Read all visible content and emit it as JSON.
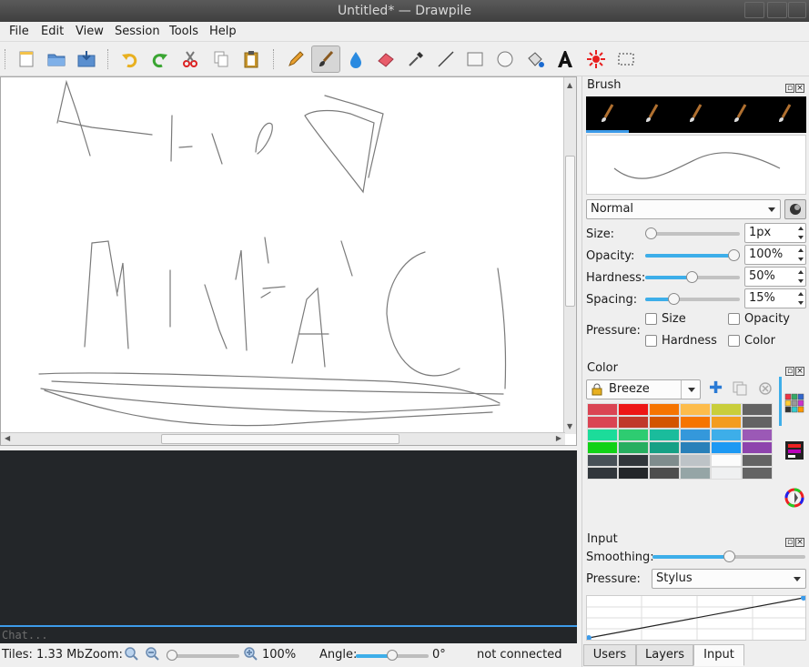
{
  "window": {
    "title": "Untitled* — Drawpile"
  },
  "menu": [
    "File",
    "Edit",
    "View",
    "Session",
    "Tools",
    "Help"
  ],
  "toolbar": {
    "file_tools": [
      "new-document-icon",
      "open-folder-icon",
      "save-icon"
    ],
    "edit_tools": [
      "undo-icon",
      "redo-icon",
      "cut-icon",
      "copy-icon",
      "paste-icon"
    ],
    "draw_tools": [
      "pencil-icon",
      "brush-icon",
      "smudge-icon",
      "eraser-icon",
      "color-picker-icon",
      "line-icon",
      "rectangle-icon",
      "ellipse-icon",
      "fill-icon",
      "text-icon",
      "laser-icon",
      "selection-icon"
    ],
    "active_tool": "brush-icon"
  },
  "chat": {
    "placeholder": "Chat..."
  },
  "status": {
    "tiles": "Tiles: 1.33 Mb",
    "zoom_label": "Zoom:",
    "zoom_value": "100%",
    "angle_label": "Angle:",
    "angle_value": "0°",
    "connection": "not connected"
  },
  "brush_dock": {
    "title": "Brush",
    "blend_mode": "Normal",
    "size_label": "Size:",
    "size_value": "1px",
    "opacity_label": "Opacity:",
    "opacity_value": "100%",
    "hardness_label": "Hardness:",
    "hardness_value": "50%",
    "spacing_label": "Spacing:",
    "spacing_value": "15%",
    "pressure_label": "Pressure:",
    "pressure_size": "Size",
    "pressure_opacity": "Opacity",
    "pressure_hardness": "Hardness",
    "pressure_color": "Color",
    "levels": {
      "size": 0.0,
      "opacity": 1.0,
      "hardness": 0.5,
      "spacing": 0.3
    }
  },
  "color_dock": {
    "title": "Color",
    "palette_name": "Breeze",
    "swatches": [
      "#da4453",
      "#ed1515",
      "#f67400",
      "#fdbc4b",
      "#c9ce3b",
      "#636363",
      "#da4453",
      "#c0392b",
      "#d35400",
      "#f67400",
      "#f39c1f",
      "#636363",
      "#1cdc9a",
      "#2ecc71",
      "#1abc9c",
      "#3498db",
      "#3daee9",
      "#9b59b6",
      "#11d116",
      "#27ae60",
      "#16a085",
      "#2980b9",
      "#1d99f3",
      "#8e44ad",
      "#475057",
      "#31363b",
      "#7f8c8d",
      "#bdc3c7",
      "#fcfcfc",
      "#636363",
      "#31363b",
      "#232629",
      "#4d4d4d",
      "#95a5a6",
      "#eff0f1",
      "#636363"
    ]
  },
  "input_dock": {
    "title": "Input",
    "smoothing_label": "Smoothing:",
    "smoothing_level": 0.5,
    "pressure_label": "Pressure:",
    "pressure_mode": "Stylus"
  },
  "tabs": [
    "Users",
    "Layers",
    "Input"
  ],
  "active_tab": "Input",
  "colors": {
    "accent": "#3daee9",
    "chat_bg": "#232629",
    "titlebar": "#474747"
  }
}
